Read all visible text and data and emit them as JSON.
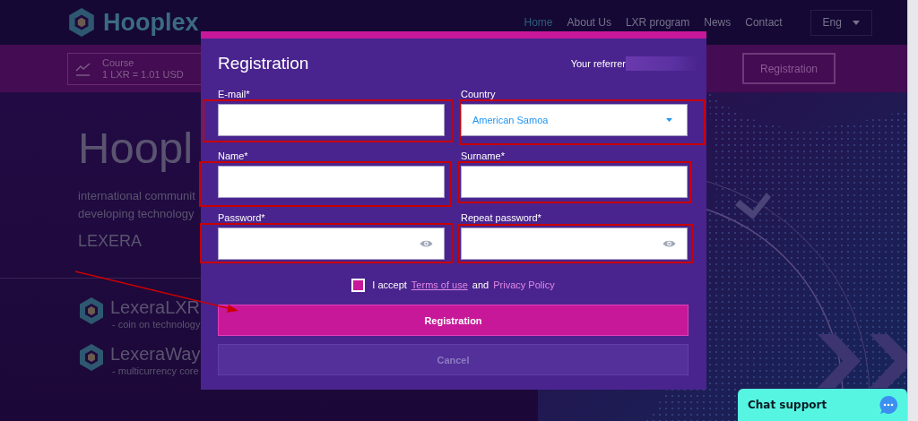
{
  "header": {
    "logo": "Hooplex",
    "nav": [
      {
        "label": "Home",
        "selected": true
      },
      {
        "label": "About Us",
        "selected": false
      },
      {
        "label": "LXR program",
        "selected": false
      },
      {
        "label": "News",
        "selected": false
      },
      {
        "label": "Contact",
        "selected": false
      }
    ],
    "language": "Eng"
  },
  "rate_bar": {
    "label": "Course",
    "rate": "1 LXR = 1.01 USD",
    "button": "Registration"
  },
  "hero": {
    "title": "Hoopl",
    "lines": [
      "international communit",
      "developing technology"
    ],
    "brand": "LEXERA",
    "products": [
      {
        "name": "LexeraLXR",
        "description": "- coin on technology"
      },
      {
        "name": "LexeraWay",
        "description": "- multicurrency core"
      }
    ]
  },
  "dialog": {
    "title": "Registration",
    "referrer_label": "Your referrer",
    "fields": [
      {
        "label": "E-mail*",
        "kind": "text",
        "highlighted": true
      },
      {
        "label": "Country",
        "kind": "select",
        "value": "American Samoa",
        "highlighted": true
      },
      {
        "label": "Name*",
        "kind": "text",
        "highlighted": true
      },
      {
        "label": "Surname*",
        "kind": "text",
        "highlighted": true
      },
      {
        "label": "Password*",
        "kind": "password",
        "highlighted": true
      },
      {
        "label": "Repeat password*",
        "kind": "password",
        "highlighted": true
      }
    ],
    "terms": {
      "checked": true,
      "prefix": "I accept",
      "terms_link": "Terms of use",
      "conjunction": "and",
      "privacy_link": "Privacy Policy"
    },
    "buttons": [
      {
        "label": "Registration",
        "kind": "primary"
      },
      {
        "label": "Cancel",
        "kind": "secondary"
      }
    ]
  },
  "pointer_arrow": true,
  "chat": {
    "label": "Chat support"
  }
}
